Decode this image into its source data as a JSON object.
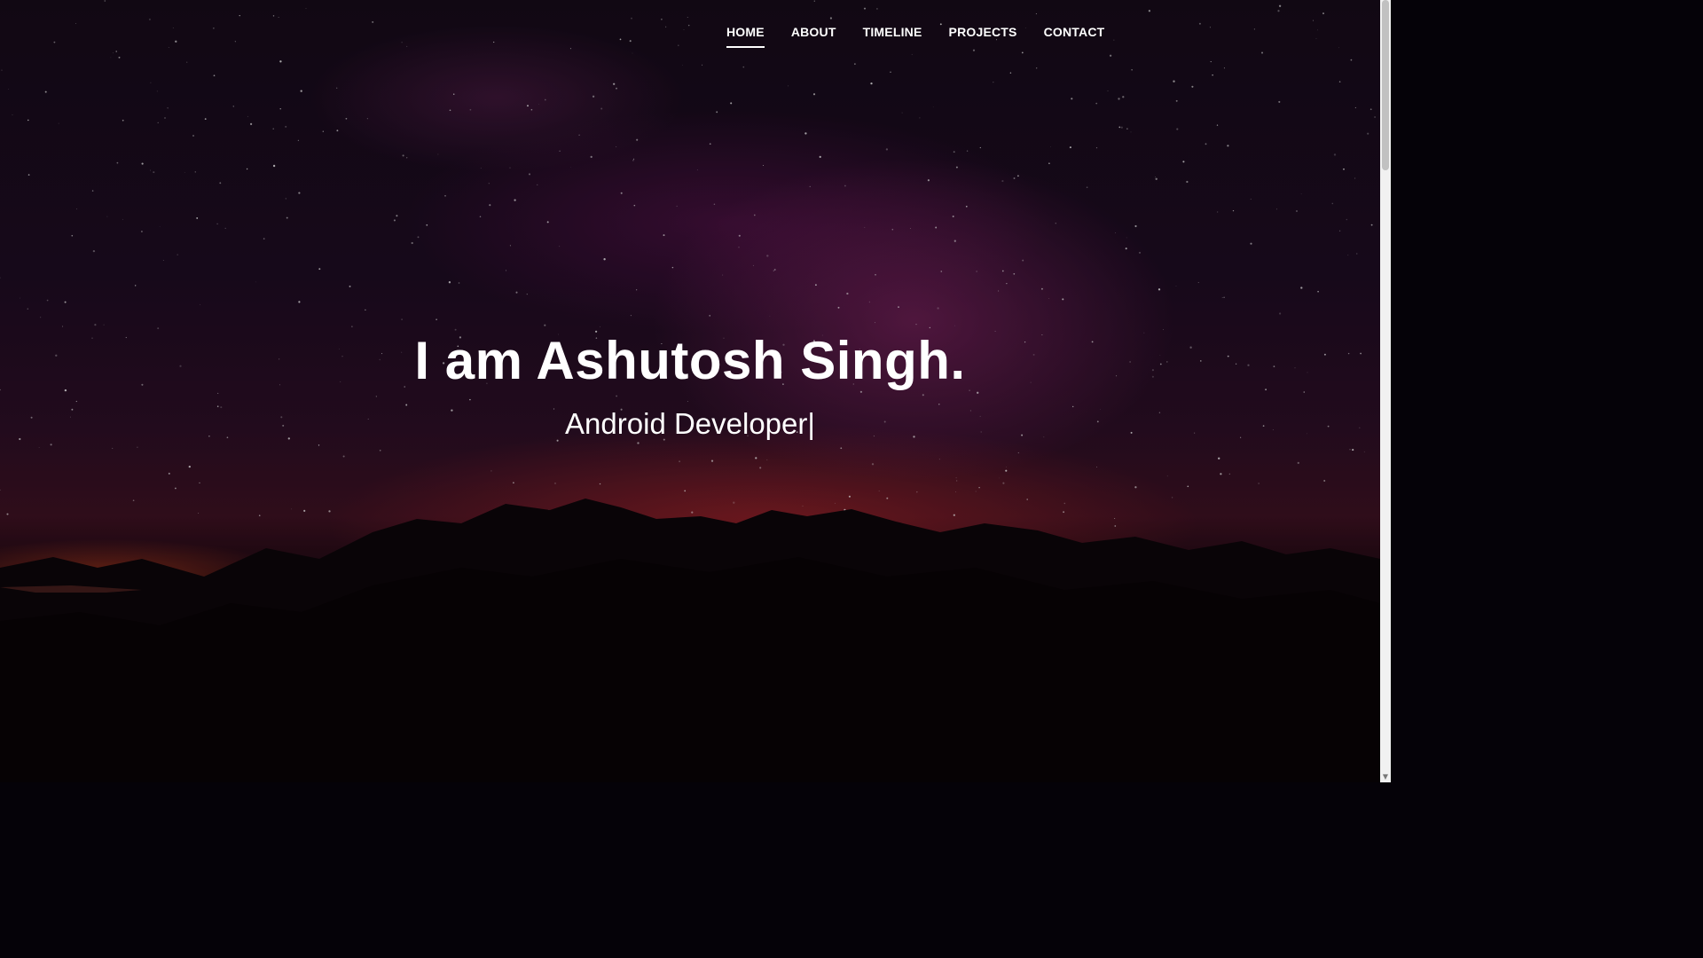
{
  "nav": {
    "items": [
      {
        "label": "HOME",
        "active": true
      },
      {
        "label": "ABOUT",
        "active": false
      },
      {
        "label": "TIMELINE",
        "active": false
      },
      {
        "label": "PROJECTS",
        "active": false
      },
      {
        "label": "CONTACT",
        "active": false
      }
    ]
  },
  "hero": {
    "title": "I am Ashutosh Singh.",
    "subtitle": "Android Developer|"
  },
  "colors": {
    "text": "#ffffff",
    "scrollbar_track": "#f1f1f1",
    "scrollbar_thumb": "#c1c1c1"
  },
  "icons": {
    "scroll_down": "triangle-down-icon"
  }
}
